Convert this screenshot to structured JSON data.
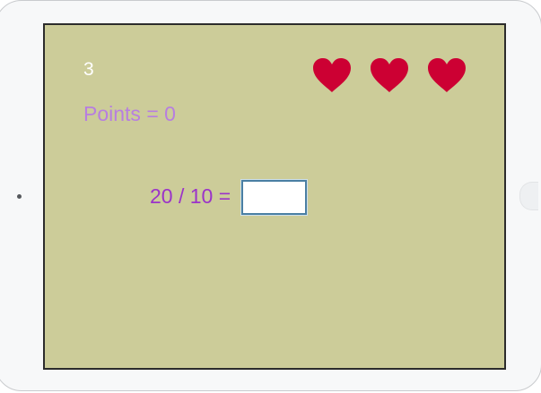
{
  "game": {
    "timer": "3",
    "lives": 3,
    "points_label": "Points",
    "points_value": "0",
    "question_text": "20 / 10 =",
    "answer_value": ""
  },
  "colors": {
    "background": "#cccc99",
    "heart": "#cc0033",
    "points_text": "#b77ee0",
    "question_text": "#9b33c9",
    "timer_text": "#ffffff"
  },
  "icons": {
    "life": "heart-icon"
  }
}
